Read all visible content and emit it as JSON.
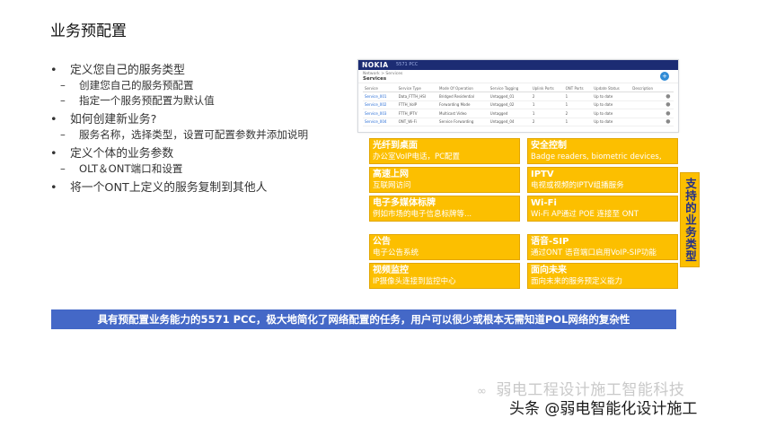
{
  "title": "业务预配置",
  "bullets": [
    {
      "level": 1,
      "text": "定义您自己的服务类型"
    },
    {
      "level": 2,
      "text": "创建您自己的服务预配置"
    },
    {
      "level": 2,
      "text": "指定一个服务预配置为默认值"
    },
    {
      "level": 1,
      "text": "如何创建新业务?"
    },
    {
      "level": 2,
      "text": "服务名称，选择类型，设置可配置参数并添加说明"
    },
    {
      "level": 1,
      "text": "定义个体的业务参数"
    },
    {
      "level": 2,
      "text": "OLT＆ONT端口和设置"
    },
    {
      "level": 1,
      "text": "将一个ONT上定义的服务复制到其他人"
    }
  ],
  "screenshot": {
    "logo": "NOKIA",
    "product": "5571 PCC",
    "nav_tabs": [
      "DASH",
      "SERVICES",
      "OLTS",
      "NETWORK"
    ],
    "nav_icons": [
      "search-icon",
      "bell-icon",
      "gear-icon",
      "user-icon"
    ],
    "user": "admin",
    "breadcrumb": "Network > Services",
    "page_title": "Services",
    "add_label": "+",
    "columns": [
      "Service",
      "Service Type",
      "Mode Of Operation",
      "Service Tagging",
      "Uplink Ports",
      "ONT Ports",
      "Update Status",
      "Description",
      ""
    ],
    "rows": [
      [
        "Service_001",
        "Data_FTTH_HSI",
        "Bridged Residential",
        "Untagged_01",
        "2",
        "1",
        "Up to date",
        "",
        "●"
      ],
      [
        "Service_002",
        "FTTH_VoIP",
        "Forwarding Mode",
        "Untagged_02",
        "1",
        "1",
        "Up to date",
        "",
        "●"
      ],
      [
        "Service_003",
        "FTTH_IPTV",
        "Multicast Video",
        "Untagged",
        "1",
        "2",
        "Up to date",
        "",
        "●"
      ],
      [
        "Service_004",
        "ONT_Wi-Fi",
        "Service Forwarding",
        "Untagged_04",
        "2",
        "1",
        "Up to date",
        "",
        "●"
      ]
    ]
  },
  "services_left": [
    {
      "name": "光纤到桌面",
      "desc": "办公室VoIP电话，PC配置"
    },
    {
      "name": "高速上网",
      "desc": "互联网访问"
    },
    {
      "name": "电子多媒体标牌",
      "desc": "例如市场的电子信息标牌等..."
    },
    {
      "name": "公告",
      "desc": "电子公告系统"
    },
    {
      "name": "视频监控",
      "desc": "IP摄像头连接到监控中心"
    }
  ],
  "services_right": [
    {
      "name": "安全控制",
      "desc": "Badge readers, biometric devices,"
    },
    {
      "name": "IPTV",
      "desc": "电视或视频的IPTV组播服务"
    },
    {
      "name": "Wi-Fi",
      "desc": "Wi-Fi AP通过 POE 连接至 ONT"
    },
    {
      "name": "语音-SIP",
      "desc": "通过ONT 语音端口启用VoIP-SIP功能"
    },
    {
      "name": "面向未来",
      "desc": "面向未来的服务预定义能力"
    }
  ],
  "side_label": "支持的业务类型",
  "banner": "具有预配置业务能力的5571 PCC，极大地简化了网络配置的任务，用户可以很少或根本无需知道POL网络的复杂性",
  "watermark": {
    "icon": "wechat-icon",
    "top": "弱电工程设计施工智能科技",
    "bottom": "头条 @弱电智能化设计施工"
  },
  "colors": {
    "accent": "#fcbf00",
    "banner": "#4468c7",
    "nav": "#1c2c73",
    "side_text": "#1f2d8a"
  }
}
